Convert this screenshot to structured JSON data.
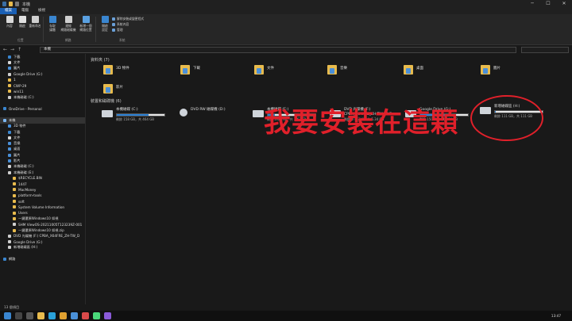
{
  "window": {
    "title": "本機",
    "minimize": "─",
    "maximize": "☐",
    "close": "✕"
  },
  "tabs": [
    "檔案",
    "電腦",
    "檢視"
  ],
  "ribbon": {
    "buttons": [
      {
        "label": "內容",
        "color": "#d9d9d9"
      },
      {
        "label": "開啟",
        "color": "#e0e0e0"
      },
      {
        "label": "重新命名",
        "color": "#cfcfcf"
      },
      {
        "label": "存取\n媒體",
        "color": "#3a86d0"
      },
      {
        "label": "連線\n網路磁碟機",
        "color": "#cfcfcf"
      },
      {
        "label": "新增一個\n網路位置",
        "color": "#5aa0e0"
      },
      {
        "label": "開啟\n設定",
        "color": "#3a86d0"
      }
    ],
    "small": [
      "解除安裝或變更程式",
      "系統內容",
      "管理"
    ],
    "groups": [
      "位置",
      "網路",
      "系統"
    ]
  },
  "address": {
    "path": "本機",
    "back": "←",
    "fwd": "→",
    "up": "↑"
  },
  "nav": [
    {
      "label": "下載",
      "color": "#3a86d0",
      "indent": 1
    },
    {
      "label": "文件",
      "color": "#d9d9d9",
      "indent": 1
    },
    {
      "label": "圖片",
      "color": "#4a90d8",
      "indent": 1
    },
    {
      "label": "Google Drive (G:)",
      "color": "#cfcfcf",
      "indent": 1
    },
    {
      "label": "1",
      "color": "#e8bb4d",
      "indent": 1
    },
    {
      "label": "CWP-29",
      "color": "#e8bb4d",
      "indent": 1
    },
    {
      "label": "win11",
      "color": "#e8bb4d",
      "indent": 1
    },
    {
      "label": "本機磁碟 (C:)",
      "color": "#cfcfcf",
      "indent": 1
    },
    {
      "label": "",
      "color": "transparent",
      "indent": 0
    },
    {
      "label": "OneDrive - Personal",
      "color": "#3a86d0",
      "indent": 0
    },
    {
      "label": "",
      "color": "transparent",
      "indent": 0
    },
    {
      "label": "本機",
      "color": "#7bb6f0",
      "indent": 0,
      "sel": true
    },
    {
      "label": "3D 物件",
      "color": "#4a90d8",
      "indent": 1
    },
    {
      "label": "下載",
      "color": "#3a86d0",
      "indent": 1
    },
    {
      "label": "文件",
      "color": "#d9d9d9",
      "indent": 1
    },
    {
      "label": "音樂",
      "color": "#4a90d8",
      "indent": 1
    },
    {
      "label": "桌面",
      "color": "#4a90d8",
      "indent": 1
    },
    {
      "label": "圖片",
      "color": "#4a90d8",
      "indent": 1
    },
    {
      "label": "影片",
      "color": "#4a90d8",
      "indent": 1
    },
    {
      "label": "本機磁碟 (C:)",
      "color": "#cfcfcf",
      "indent": 1
    },
    {
      "label": "本機磁碟 (E:)",
      "color": "#cfcfcf",
      "indent": 1
    },
    {
      "label": "$RECYCLE.BIN",
      "color": "#e8bb4d",
      "indent": 2
    },
    {
      "label": "1447",
      "color": "#e8bb4d",
      "indent": 2
    },
    {
      "label": "MacMoney",
      "color": "#e8bb4d",
      "indent": 2
    },
    {
      "label": "platform-tools",
      "color": "#e8bb4d",
      "indent": 2
    },
    {
      "label": "soft",
      "color": "#e8bb4d",
      "indent": 2
    },
    {
      "label": "System Volume Information",
      "color": "#e8bb4d",
      "indent": 2
    },
    {
      "label": "Users",
      "color": "#e8bb4d",
      "indent": 2
    },
    {
      "label": "一鍵還原Windows10 如視",
      "color": "#e8bb4d",
      "indent": 2
    },
    {
      "label": "SHM ViewOS-20211005T123239Z-001",
      "color": "#cfcfcf",
      "indent": 2
    },
    {
      "label": "一鍵還原Windows10 如視.zip",
      "color": "#e8bb4d",
      "indent": 2
    },
    {
      "label": "DVD 光碟機 (F:) CPBA_X64FRE_ZH-TW_D",
      "color": "#cfcfcf",
      "indent": 1
    },
    {
      "label": "Google Drive (G:)",
      "color": "#cfcfcf",
      "indent": 1
    },
    {
      "label": "新增磁碟區 (H:)",
      "color": "#cfcfcf",
      "indent": 1
    },
    {
      "label": "",
      "color": "transparent",
      "indent": 0
    },
    {
      "label": "網路",
      "color": "#3a86d0",
      "indent": 0
    }
  ],
  "sections": {
    "folders": "資料夾 (7)",
    "drives": "裝置和磁碟機 (6)"
  },
  "folders": [
    "3D 物件",
    "下載",
    "文件",
    "音樂",
    "桌面",
    "圖片",
    "影片"
  ],
  "drives": [
    {
      "name": "本機磁碟 (C:)",
      "free": "剩餘 158 GB，共 464 GB",
      "used": 0.66
    },
    {
      "name": "DVD RW 磁碟機 (D:)",
      "free": "",
      "used": null
    },
    {
      "name": "本機磁碟 (E:)",
      "free": "剩餘 3.07 TB，共 3.63 TB",
      "used": 0.15
    },
    {
      "name": "DVD 光碟機 (F:)\nCPBA_X64FRE_ZH-TW_DV9",
      "free": "剩餘 0 位元組，共 5.34 GB",
      "used": null
    },
    {
      "name": "Google Drive (G:)",
      "free": "剩餘 150 GB，共 464 GB",
      "used": 0.68
    },
    {
      "name": "新增磁碟區 (H:)",
      "free": "剩餘 111 GB，共 111 GB",
      "used": 0.01
    }
  ],
  "annotation": "我要安裝在這顆",
  "status": "13 個項目",
  "clock": "13:47"
}
